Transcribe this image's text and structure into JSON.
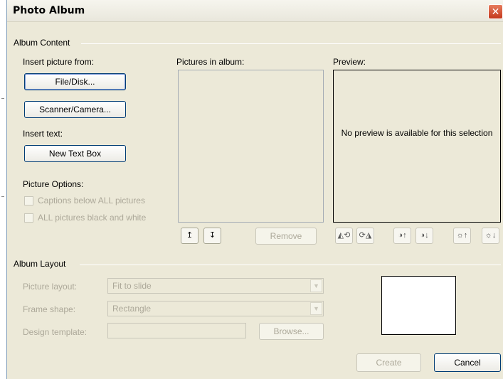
{
  "dialog": {
    "title": "Photo Album",
    "close_glyph": "✕"
  },
  "album_content": {
    "group_label": "Album Content",
    "insert_picture_label": "Insert picture from:",
    "file_disk_button": "File/Disk...",
    "scanner_camera_button": "Scanner/Camera...",
    "insert_text_label": "Insert text:",
    "new_text_box_button": "New Text Box",
    "picture_options_label": "Picture Options:",
    "captions_checkbox": "Captions below ALL pictures",
    "black_white_checkbox": "ALL pictures black and white",
    "pictures_in_album_label": "Pictures in album:",
    "move_up_glyph": "↥",
    "move_down_glyph": "↧",
    "remove_button": "Remove",
    "preview_label": "Preview:",
    "preview_message": "No preview is available for this selection",
    "tool_icons": [
      {
        "name": "rotate-left-icon",
        "glyph": "◭⟲"
      },
      {
        "name": "rotate-right-icon",
        "glyph": "⟳◮"
      },
      {
        "name": "contrast-up-icon",
        "glyph": "◑↑"
      },
      {
        "name": "contrast-down-icon",
        "glyph": "◑↓"
      },
      {
        "name": "brightness-up-icon",
        "glyph": "☼↑"
      },
      {
        "name": "brightness-down-icon",
        "glyph": "☼↓"
      }
    ]
  },
  "album_layout": {
    "group_label": "Album Layout",
    "picture_layout_label": "Picture layout:",
    "picture_layout_value": "Fit to slide",
    "frame_shape_label": "Frame shape:",
    "frame_shape_value": "Rectangle",
    "design_template_label": "Design template:",
    "design_template_value": "",
    "browse_button": "Browse...",
    "dropdown_glyph": "▼"
  },
  "footer": {
    "create_button": "Create",
    "cancel_button": "Cancel"
  }
}
